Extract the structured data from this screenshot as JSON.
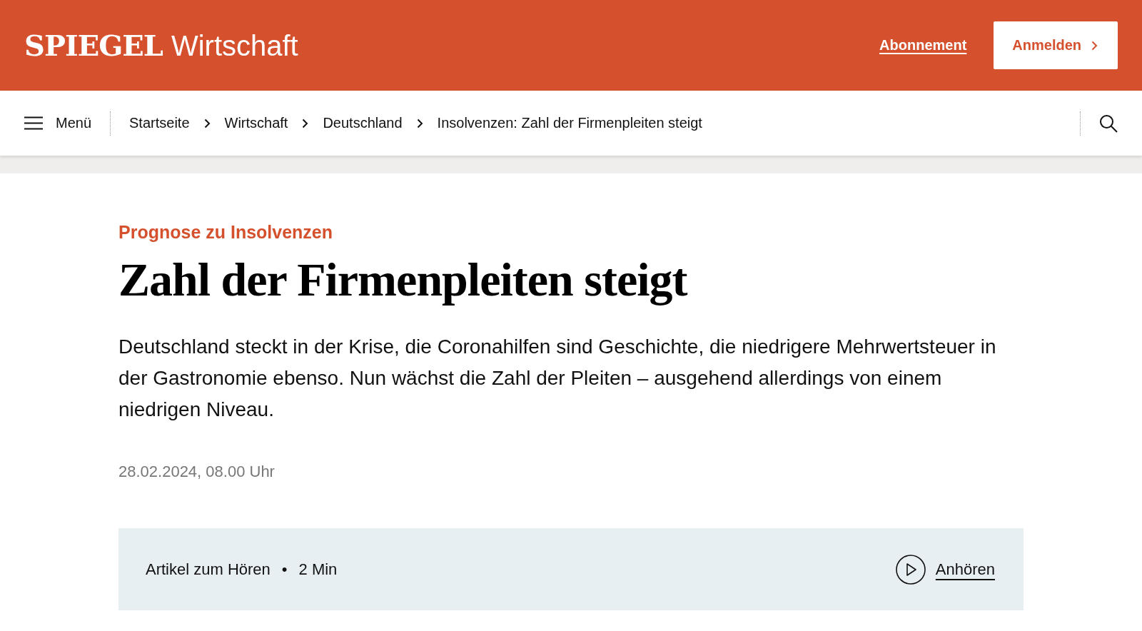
{
  "header": {
    "logo": "SPIEGEL",
    "section": "Wirtschaft",
    "subscribe_link": "Abonnement",
    "login_button": "Anmelden"
  },
  "nav": {
    "menu_label": "Menü",
    "breadcrumbs": [
      "Startseite",
      "Wirtschaft",
      "Deutschland",
      "Insolvenzen: Zahl der Firmenpleiten steigt"
    ]
  },
  "article": {
    "kicker": "Prognose zu Insolvenzen",
    "title": "Zahl der Firmenpleiten steigt",
    "lead": "Deutschland steckt in der Krise, die Coronahilfen sind Geschichte, die niedrigere Mehrwertsteuer in der Gastronomie ebenso. Nun wächst die Zahl der Pleiten – ausgehend allerdings von einem niedrigen Niveau.",
    "date": "28.02.2024, 08.00 Uhr"
  },
  "audio": {
    "label": "Artikel zum Hören",
    "separator": "•",
    "duration": "2 Min",
    "play_label": "Anhören"
  }
}
